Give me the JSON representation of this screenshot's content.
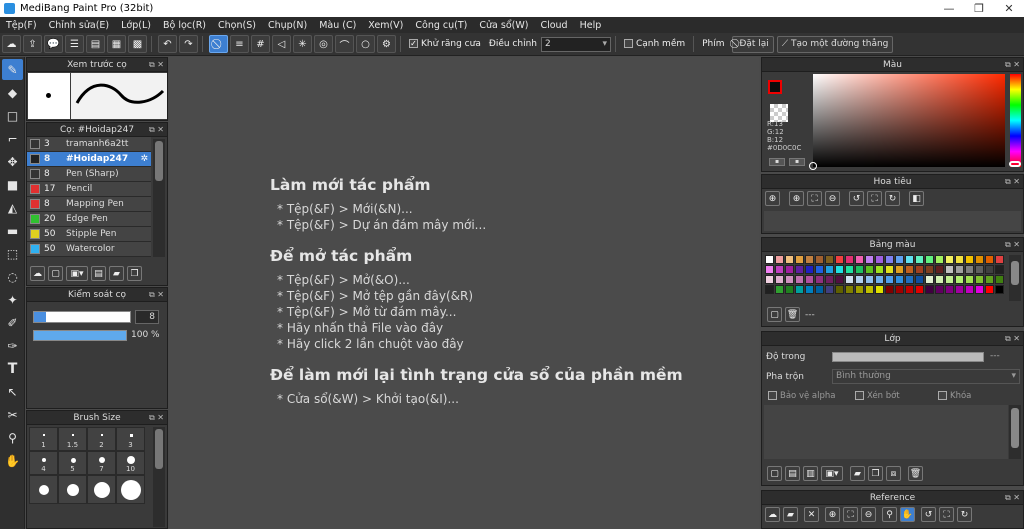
{
  "window": {
    "title": "MediBang Paint Pro (32bit)"
  },
  "menu": [
    "Tệp(F)",
    "Chỉnh sửa(E)",
    "Lớp(L)",
    "Bộ lọc(R)",
    "Chọn(S)",
    "Chụp(N)",
    "Màu (C)",
    "Xem(V)",
    "Công cụ(T)",
    "Cửa sổ(W)",
    "Cloud",
    "Help"
  ],
  "toolbar": {
    "antialias_label": "Khử răng cưa",
    "adjust_label": "Điều chỉnh",
    "adjust_value": "2",
    "edge_label": "Cạnh mềm",
    "pen_label": "Phím",
    "set_label": "Đặt lại",
    "line_label": "Tạo một đường thẳng"
  },
  "preview": {
    "title": "Xem trước cọ"
  },
  "brush": {
    "title": "Cọ: #Hoidap247",
    "items": [
      {
        "size": "3",
        "name": "tramanh6a2tt",
        "color": "#333333"
      },
      {
        "size": "8",
        "name": "#Hoidap247",
        "color": "#222222"
      },
      {
        "size": "8",
        "name": "Pen (Sharp)",
        "color": "#333333"
      },
      {
        "size": "17",
        "name": "Pencil",
        "color": "#e03030"
      },
      {
        "size": "8",
        "name": "Mapping Pen",
        "color": "#e03030"
      },
      {
        "size": "20",
        "name": "Edge Pen",
        "color": "#30c030"
      },
      {
        "size": "50",
        "name": "Stipple Pen",
        "color": "#e0d020"
      },
      {
        "size": "50",
        "name": "Watercolor",
        "color": "#30b0f0"
      }
    ]
  },
  "control": {
    "title": "Kiểm soát cọ",
    "size": "8",
    "opacity": "100 %"
  },
  "brushsize": {
    "title": "Brush Size",
    "labels": [
      "1",
      "1.5",
      "2",
      "3",
      "4",
      "5",
      "7",
      "10"
    ]
  },
  "canvas": {
    "h1": "Làm mới tác phẩm",
    "l1": [
      "* Tệp(&F) > Mới(&N)...",
      "* Tệp(&F) > Dự án đám mây mới..."
    ],
    "h2": "Để mở tác phẩm",
    "l2": [
      "* Tệp(&F) > Mở(&O)...",
      "* Tệp(&F) > Mở tệp gần đây(&R)",
      "* Tệp(&F) > Mở từ đám mây...",
      "* Hãy nhấn thả File vào đây",
      "* Hãy click 2 lần chuột vào đây"
    ],
    "h3": "Để làm mới lại tình trạng cửa sổ của phần mềm",
    "l3": [
      "* Cửa sổ(&W) > Khởi tạo(&I)..."
    ]
  },
  "color": {
    "title": "Màu",
    "r": "R:13",
    "g": "G:12",
    "b": "B:12",
    "hex": "#0D0C0C"
  },
  "nav": {
    "title": "Hoa tiêu"
  },
  "palette": {
    "title": "Bảng màu",
    "dash": "---"
  },
  "layer": {
    "title": "Lớp",
    "opacity_label": "Độ trong",
    "opacity_value": "---",
    "blend_label": "Pha trộn",
    "blend_value": "Bình thường",
    "protect_label": "Bảo vệ alpha",
    "clip_label": "Xén bớt",
    "lock_label": "Khóa"
  },
  "reference": {
    "title": "Reference"
  },
  "accent": "#3d7fd1"
}
